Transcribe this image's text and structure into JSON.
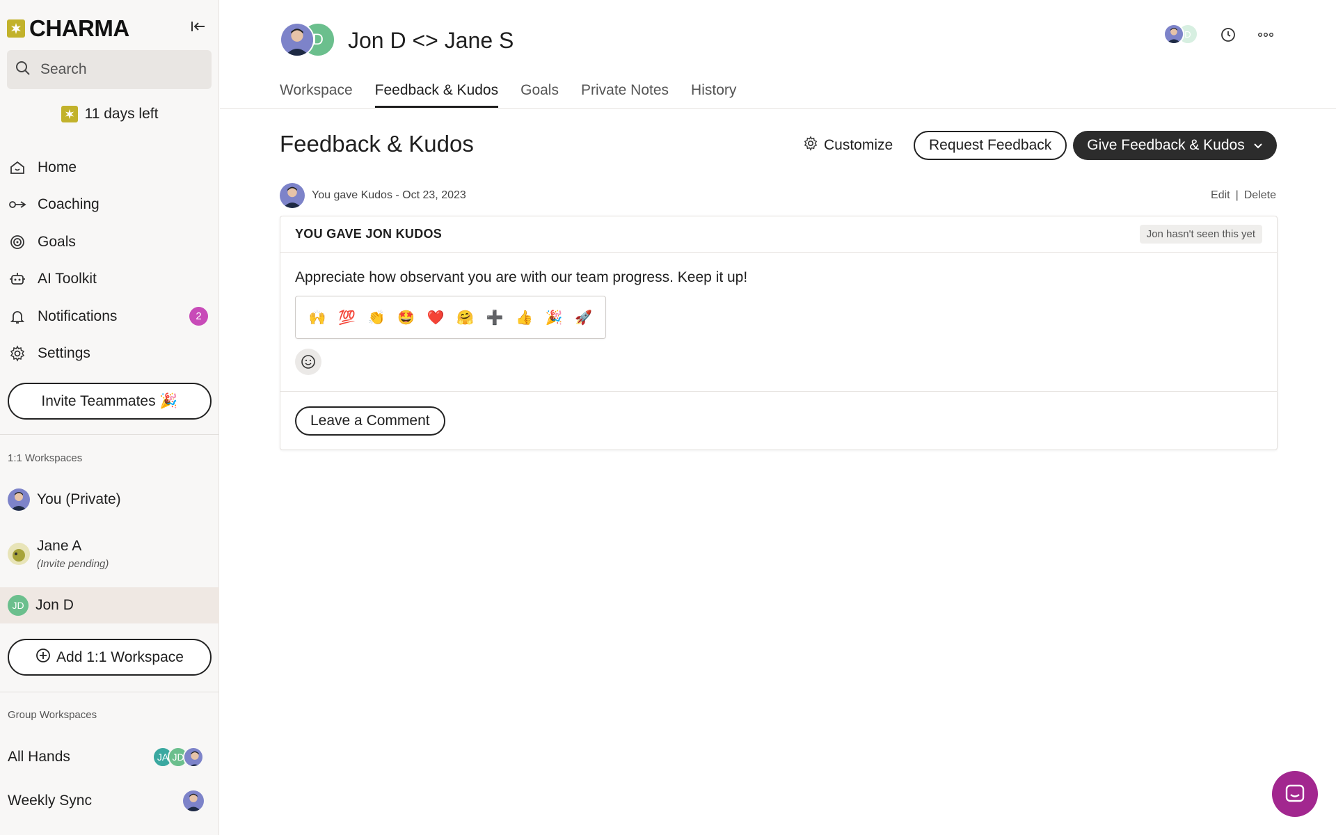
{
  "brand": {
    "name": "CHARMA"
  },
  "search": {
    "placeholder": "Search"
  },
  "trial": {
    "text": "11 days left"
  },
  "nav": [
    {
      "label": "Home",
      "icon": "home-icon"
    },
    {
      "label": "Coaching",
      "icon": "coaching-icon"
    },
    {
      "label": "Goals",
      "icon": "target-icon"
    },
    {
      "label": "AI Toolkit",
      "icon": "robot-icon"
    },
    {
      "label": "Notifications",
      "icon": "bell-icon",
      "badge": "2"
    },
    {
      "label": "Settings",
      "icon": "gear-icon"
    }
  ],
  "invite_button": "Invite Teammates 🎉",
  "one_on_one": {
    "label": "1:1 Workspaces",
    "items": [
      {
        "label": "You (Private)"
      },
      {
        "label": "Jane A",
        "sub": "(Invite pending)"
      },
      {
        "label": "Jon D",
        "initials": "JD"
      }
    ],
    "add_button": "Add 1:1 Workspace"
  },
  "groups": {
    "label": "Group Workspaces",
    "items": [
      {
        "label": "All Hands",
        "avatars": [
          "JA",
          "JD"
        ]
      },
      {
        "label": "Weekly Sync"
      }
    ]
  },
  "workspace": {
    "title": "Jon D <> Jane S",
    "partner_initial": "D",
    "mini_initial": "D"
  },
  "tabs": [
    "Workspace",
    "Feedback & Kudos",
    "Goals",
    "Private Notes",
    "History"
  ],
  "active_tab": "Feedback & Kudos",
  "page": {
    "title": "Feedback & Kudos",
    "customize": "Customize",
    "request_button": "Request Feedback",
    "give_button": "Give Feedback & Kudos"
  },
  "entry": {
    "meta": "You gave Kudos - Oct 23, 2023",
    "edit": "Edit",
    "separator": "|",
    "delete": "Delete",
    "card_title": "YOU GAVE JON KUDOS",
    "seen_status": "Jon hasn't seen this yet",
    "message": "Appreciate how observant you are with our team progress. Keep it up!",
    "reactions": [
      "🙌",
      "💯",
      "👏",
      "🤩",
      "❤️",
      "🤗",
      "➕",
      "👍",
      "🎉",
      "🚀"
    ],
    "comment_button": "Leave a Comment"
  },
  "colors": {
    "brand": "#c2b22b",
    "badge": "#c84bb8",
    "primary_dark": "#2c2c2c",
    "chat": "#a2278f",
    "avatar_green": "#6bbf8d",
    "active_row": "#efe8e3"
  }
}
